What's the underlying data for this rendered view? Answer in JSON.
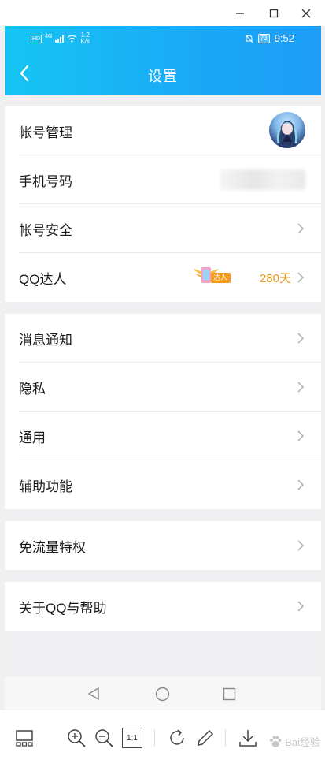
{
  "window": {
    "controls": [
      {
        "name": "minimize",
        "icon": "minimize-icon"
      },
      {
        "name": "maximize",
        "icon": "maximize-icon"
      },
      {
        "name": "close",
        "icon": "close-icon"
      }
    ]
  },
  "statusbar": {
    "hd": "HD",
    "network": "4G",
    "speed_value": "1.2",
    "speed_unit": "K/s",
    "battery": "73",
    "time": "9:52"
  },
  "header": {
    "title": "设置",
    "back_icon": "back-arrow-icon",
    "gradient": [
      "#16c5f4",
      "#1c9df7"
    ]
  },
  "groups": [
    {
      "items": [
        {
          "label": "帐号管理",
          "accessory": "avatar"
        },
        {
          "label": "手机号码",
          "accessory": "blurred-number"
        },
        {
          "label": "帐号安全",
          "accessory": "chevron"
        },
        {
          "label": "QQ达人",
          "accessory": "badge",
          "badge_text": "达人",
          "days": "280天"
        }
      ]
    },
    {
      "items": [
        {
          "label": "消息通知",
          "accessory": "chevron"
        },
        {
          "label": "隐私",
          "accessory": "chevron"
        },
        {
          "label": "通用",
          "accessory": "chevron"
        },
        {
          "label": "辅助功能",
          "accessory": "chevron"
        }
      ]
    },
    {
      "items": [
        {
          "label": "免流量特权",
          "accessory": "chevron"
        }
      ]
    },
    {
      "items": [
        {
          "label": "关于QQ与帮助",
          "accessory": "chevron"
        }
      ]
    }
  ],
  "system_nav": [
    "back-triangle-icon",
    "home-circle-icon",
    "recent-square-icon"
  ],
  "toolbar": {
    "icons": [
      "thumbnail-view-icon",
      "zoom-in-icon",
      "zoom-out-icon",
      "actual-size-icon",
      "rotate-icon",
      "edit-pencil-icon",
      "download-icon"
    ],
    "actual_size_label": "1:1",
    "watermark": "Bai经验"
  },
  "colors": {
    "accent": "#1aa9f6",
    "days_text": "#e49a1c",
    "page_bg": "#f0f0f2"
  }
}
